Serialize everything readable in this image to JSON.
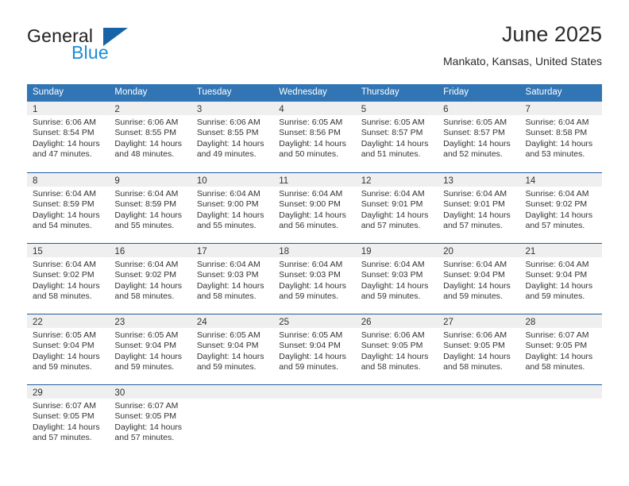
{
  "logo": {
    "primary_text": "General",
    "secondary_text": "Blue",
    "accent_color": "#1763a8",
    "blue_text_color": "#1d8bd8"
  },
  "header": {
    "title": "June 2025",
    "subtitle": "Mankato, Kansas, United States"
  },
  "theme": {
    "header_blue": "#3175b4",
    "row_rule_blue": "#1f5c9e",
    "day_band_gray": "#efefef"
  },
  "weekdays": [
    "Sunday",
    "Monday",
    "Tuesday",
    "Wednesday",
    "Thursday",
    "Friday",
    "Saturday"
  ],
  "weeks": [
    [
      {
        "day": "1",
        "sunrise": "Sunrise: 6:06 AM",
        "sunset": "Sunset: 8:54 PM",
        "daylight_line1": "Daylight: 14 hours",
        "daylight_line2": "and 47 minutes."
      },
      {
        "day": "2",
        "sunrise": "Sunrise: 6:06 AM",
        "sunset": "Sunset: 8:55 PM",
        "daylight_line1": "Daylight: 14 hours",
        "daylight_line2": "and 48 minutes."
      },
      {
        "day": "3",
        "sunrise": "Sunrise: 6:06 AM",
        "sunset": "Sunset: 8:55 PM",
        "daylight_line1": "Daylight: 14 hours",
        "daylight_line2": "and 49 minutes."
      },
      {
        "day": "4",
        "sunrise": "Sunrise: 6:05 AM",
        "sunset": "Sunset: 8:56 PM",
        "daylight_line1": "Daylight: 14 hours",
        "daylight_line2": "and 50 minutes."
      },
      {
        "day": "5",
        "sunrise": "Sunrise: 6:05 AM",
        "sunset": "Sunset: 8:57 PM",
        "daylight_line1": "Daylight: 14 hours",
        "daylight_line2": "and 51 minutes."
      },
      {
        "day": "6",
        "sunrise": "Sunrise: 6:05 AM",
        "sunset": "Sunset: 8:57 PM",
        "daylight_line1": "Daylight: 14 hours",
        "daylight_line2": "and 52 minutes."
      },
      {
        "day": "7",
        "sunrise": "Sunrise: 6:04 AM",
        "sunset": "Sunset: 8:58 PM",
        "daylight_line1": "Daylight: 14 hours",
        "daylight_line2": "and 53 minutes."
      }
    ],
    [
      {
        "day": "8",
        "sunrise": "Sunrise: 6:04 AM",
        "sunset": "Sunset: 8:59 PM",
        "daylight_line1": "Daylight: 14 hours",
        "daylight_line2": "and 54 minutes."
      },
      {
        "day": "9",
        "sunrise": "Sunrise: 6:04 AM",
        "sunset": "Sunset: 8:59 PM",
        "daylight_line1": "Daylight: 14 hours",
        "daylight_line2": "and 55 minutes."
      },
      {
        "day": "10",
        "sunrise": "Sunrise: 6:04 AM",
        "sunset": "Sunset: 9:00 PM",
        "daylight_line1": "Daylight: 14 hours",
        "daylight_line2": "and 55 minutes."
      },
      {
        "day": "11",
        "sunrise": "Sunrise: 6:04 AM",
        "sunset": "Sunset: 9:00 PM",
        "daylight_line1": "Daylight: 14 hours",
        "daylight_line2": "and 56 minutes."
      },
      {
        "day": "12",
        "sunrise": "Sunrise: 6:04 AM",
        "sunset": "Sunset: 9:01 PM",
        "daylight_line1": "Daylight: 14 hours",
        "daylight_line2": "and 57 minutes."
      },
      {
        "day": "13",
        "sunrise": "Sunrise: 6:04 AM",
        "sunset": "Sunset: 9:01 PM",
        "daylight_line1": "Daylight: 14 hours",
        "daylight_line2": "and 57 minutes."
      },
      {
        "day": "14",
        "sunrise": "Sunrise: 6:04 AM",
        "sunset": "Sunset: 9:02 PM",
        "daylight_line1": "Daylight: 14 hours",
        "daylight_line2": "and 57 minutes."
      }
    ],
    [
      {
        "day": "15",
        "sunrise": "Sunrise: 6:04 AM",
        "sunset": "Sunset: 9:02 PM",
        "daylight_line1": "Daylight: 14 hours",
        "daylight_line2": "and 58 minutes."
      },
      {
        "day": "16",
        "sunrise": "Sunrise: 6:04 AM",
        "sunset": "Sunset: 9:02 PM",
        "daylight_line1": "Daylight: 14 hours",
        "daylight_line2": "and 58 minutes."
      },
      {
        "day": "17",
        "sunrise": "Sunrise: 6:04 AM",
        "sunset": "Sunset: 9:03 PM",
        "daylight_line1": "Daylight: 14 hours",
        "daylight_line2": "and 58 minutes."
      },
      {
        "day": "18",
        "sunrise": "Sunrise: 6:04 AM",
        "sunset": "Sunset: 9:03 PM",
        "daylight_line1": "Daylight: 14 hours",
        "daylight_line2": "and 59 minutes."
      },
      {
        "day": "19",
        "sunrise": "Sunrise: 6:04 AM",
        "sunset": "Sunset: 9:03 PM",
        "daylight_line1": "Daylight: 14 hours",
        "daylight_line2": "and 59 minutes."
      },
      {
        "day": "20",
        "sunrise": "Sunrise: 6:04 AM",
        "sunset": "Sunset: 9:04 PM",
        "daylight_line1": "Daylight: 14 hours",
        "daylight_line2": "and 59 minutes."
      },
      {
        "day": "21",
        "sunrise": "Sunrise: 6:04 AM",
        "sunset": "Sunset: 9:04 PM",
        "daylight_line1": "Daylight: 14 hours",
        "daylight_line2": "and 59 minutes."
      }
    ],
    [
      {
        "day": "22",
        "sunrise": "Sunrise: 6:05 AM",
        "sunset": "Sunset: 9:04 PM",
        "daylight_line1": "Daylight: 14 hours",
        "daylight_line2": "and 59 minutes."
      },
      {
        "day": "23",
        "sunrise": "Sunrise: 6:05 AM",
        "sunset": "Sunset: 9:04 PM",
        "daylight_line1": "Daylight: 14 hours",
        "daylight_line2": "and 59 minutes."
      },
      {
        "day": "24",
        "sunrise": "Sunrise: 6:05 AM",
        "sunset": "Sunset: 9:04 PM",
        "daylight_line1": "Daylight: 14 hours",
        "daylight_line2": "and 59 minutes."
      },
      {
        "day": "25",
        "sunrise": "Sunrise: 6:05 AM",
        "sunset": "Sunset: 9:04 PM",
        "daylight_line1": "Daylight: 14 hours",
        "daylight_line2": "and 59 minutes."
      },
      {
        "day": "26",
        "sunrise": "Sunrise: 6:06 AM",
        "sunset": "Sunset: 9:05 PM",
        "daylight_line1": "Daylight: 14 hours",
        "daylight_line2": "and 58 minutes."
      },
      {
        "day": "27",
        "sunrise": "Sunrise: 6:06 AM",
        "sunset": "Sunset: 9:05 PM",
        "daylight_line1": "Daylight: 14 hours",
        "daylight_line2": "and 58 minutes."
      },
      {
        "day": "28",
        "sunrise": "Sunrise: 6:07 AM",
        "sunset": "Sunset: 9:05 PM",
        "daylight_line1": "Daylight: 14 hours",
        "daylight_line2": "and 58 minutes."
      }
    ],
    [
      {
        "day": "29",
        "sunrise": "Sunrise: 6:07 AM",
        "sunset": "Sunset: 9:05 PM",
        "daylight_line1": "Daylight: 14 hours",
        "daylight_line2": "and 57 minutes."
      },
      {
        "day": "30",
        "sunrise": "Sunrise: 6:07 AM",
        "sunset": "Sunset: 9:05 PM",
        "daylight_line1": "Daylight: 14 hours",
        "daylight_line2": "and 57 minutes."
      },
      {
        "day": "",
        "sunrise": "",
        "sunset": "",
        "daylight_line1": "",
        "daylight_line2": ""
      },
      {
        "day": "",
        "sunrise": "",
        "sunset": "",
        "daylight_line1": "",
        "daylight_line2": ""
      },
      {
        "day": "",
        "sunrise": "",
        "sunset": "",
        "daylight_line1": "",
        "daylight_line2": ""
      },
      {
        "day": "",
        "sunrise": "",
        "sunset": "",
        "daylight_line1": "",
        "daylight_line2": ""
      },
      {
        "day": "",
        "sunrise": "",
        "sunset": "",
        "daylight_line1": "",
        "daylight_line2": ""
      }
    ]
  ]
}
